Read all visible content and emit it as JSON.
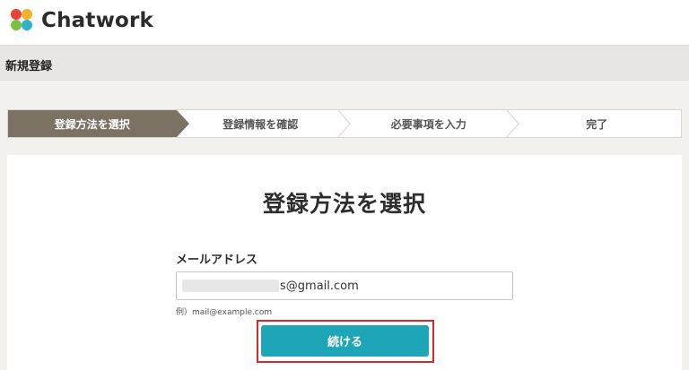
{
  "app": {
    "brand": "Chatwork",
    "logo_colors": [
      "#e5423a",
      "#f0b22d",
      "#2fb3c7",
      "#7bc043"
    ]
  },
  "header": {
    "title": "新規登録"
  },
  "stepper": {
    "steps": [
      {
        "label": "登録方法を選択",
        "active": true
      },
      {
        "label": "登録情報を確認",
        "active": false
      },
      {
        "label": "必要事項を入力",
        "active": false
      },
      {
        "label": "完了",
        "active": false
      }
    ]
  },
  "form": {
    "title": "登録方法を選択",
    "email_label": "メールアドレス",
    "email_value_visible": "s@gmail.com",
    "email_hint": "例）mail@example.com",
    "submit_label": "続ける"
  },
  "colors": {
    "active_step": "#7b7264",
    "button": "#1ea6b8",
    "highlight_outline": "#d52a2a"
  }
}
